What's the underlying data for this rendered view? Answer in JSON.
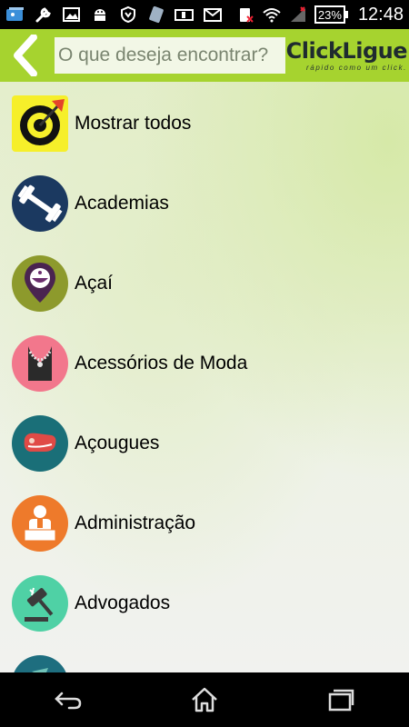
{
  "status_bar": {
    "icons": [
      "gallery-icon",
      "wrench-icon",
      "image-icon",
      "android-icon",
      "shield-icon",
      "sim-icon",
      "battery-mode-icon",
      "mail-icon",
      "no-sim-icon",
      "wifi-icon",
      "signal-icon"
    ],
    "battery": "23%",
    "time": "12:48"
  },
  "header": {
    "back_icon": "chevron-left-icon",
    "search_placeholder": "O que deseja encontrar?",
    "logo_text": "ClickLigue",
    "logo_tagline": "rápido como um click."
  },
  "categories": [
    {
      "label": "Mostrar todos",
      "icon": "target-icon",
      "color": "#f6ef2a"
    },
    {
      "label": "Academias",
      "icon": "dumbbell-icon",
      "color": "#1b3960"
    },
    {
      "label": "Açaí",
      "icon": "acai-bowl-icon",
      "color": "#8d9a2c"
    },
    {
      "label": "Acessórios de Moda",
      "icon": "necklace-icon",
      "color": "#f2778c"
    },
    {
      "label": "Açougues",
      "icon": "meat-icon",
      "color": "#1a6f78"
    },
    {
      "label": "Administração",
      "icon": "administrator-icon",
      "color": "#ee7a2b"
    },
    {
      "label": "Advogados",
      "icon": "gavel-icon",
      "color": "#4fd1a5"
    },
    {
      "label": "",
      "icon": "partial-icon",
      "color": "#1e6e7f"
    }
  ],
  "nav_bar": {
    "back": "back-icon",
    "home": "home-icon",
    "recents": "recent-apps-icon"
  }
}
